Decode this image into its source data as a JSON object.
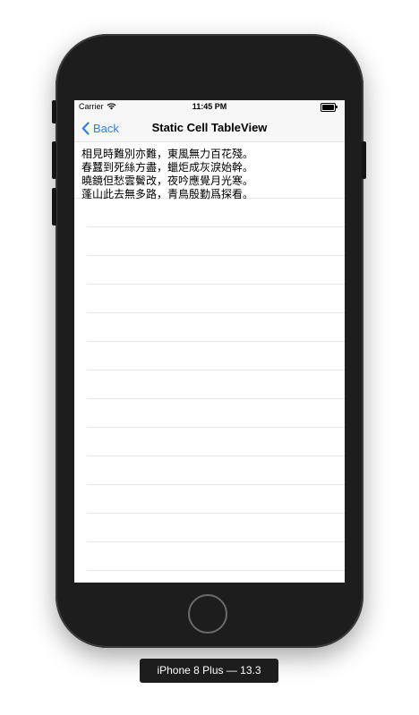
{
  "device": {
    "label": "iPhone 8 Plus — 13.3"
  },
  "status_bar": {
    "carrier": "Carrier",
    "time": "11:45 PM",
    "icons": [
      "wifi-icon",
      "battery-icon"
    ]
  },
  "nav_bar": {
    "back_label": "Back",
    "title": "Static Cell TableView",
    "accent_color": "#2f7cf6"
  },
  "table": {
    "poem_lines": [
      "相見時難別亦難，東風無力百花殘。",
      "春蠶到死絲方盡，蠟炬成灰淚始幹。",
      "曉鏡但愁雲鬢改，夜吟應覺月光寒。",
      "蓬山此去無多路，青鳥殷勤爲探看。"
    ]
  }
}
